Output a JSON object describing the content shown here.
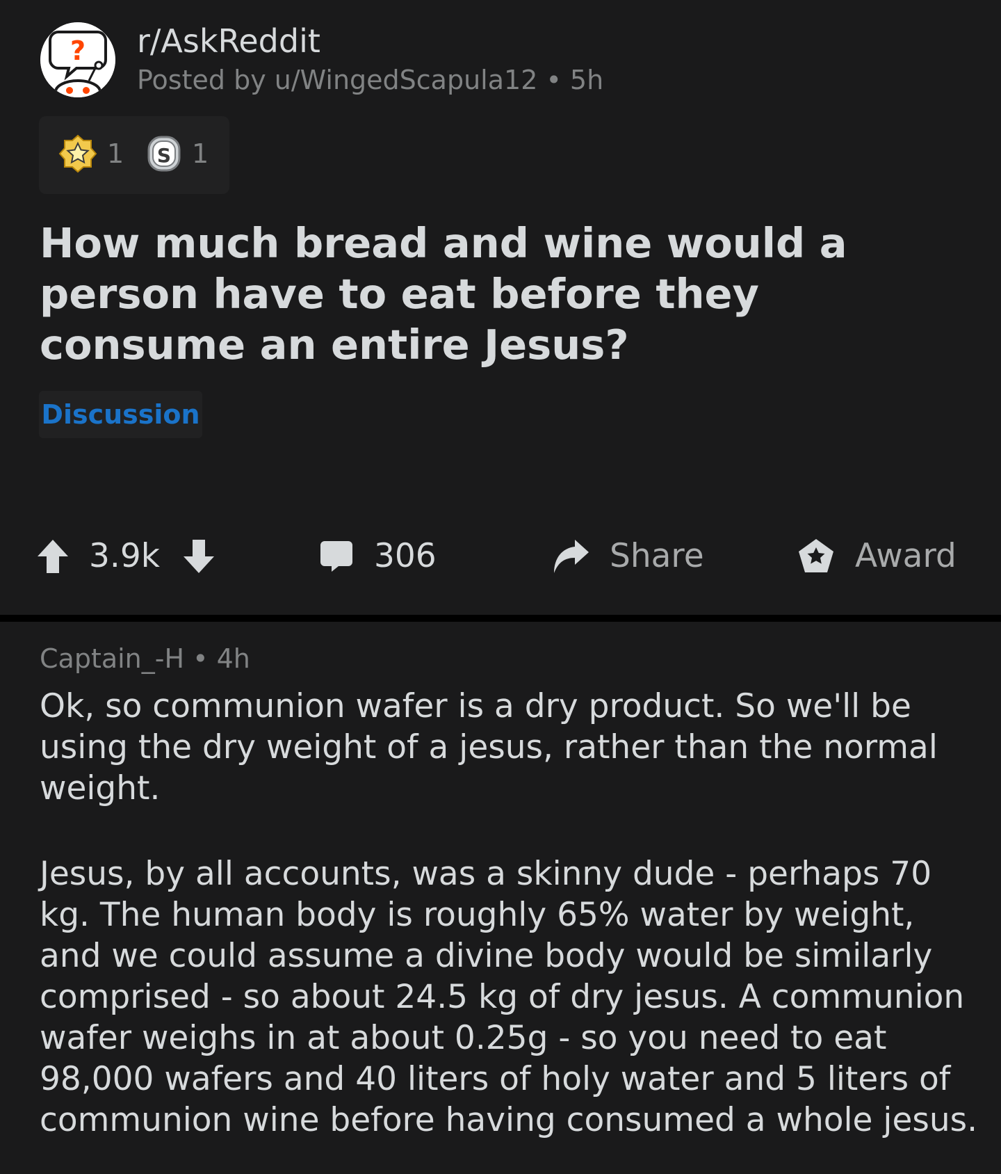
{
  "colors": {
    "background": "#1a1a1b",
    "separator": "#000000",
    "text_primary": "#d7dadc",
    "text_secondary": "#818384",
    "flair_text": "#1a73c9",
    "avatar_question_mark": "#ff4500"
  },
  "post": {
    "subreddit": "r/AskReddit",
    "posted_by": "Posted by u/WingedScapula12 • 5h",
    "avatar_icon": "askreddit-snoo-question-icon",
    "awards": [
      {
        "icon": "gold-star-award-icon",
        "count": "1"
      },
      {
        "icon": "silver-coin-award-icon",
        "count": "1"
      }
    ],
    "title": "How much bread and wine would a person have to eat before they consume an entire Jesus?",
    "flair": "Discussion"
  },
  "actions": {
    "upvote_icon": "upvote-arrow-icon",
    "score": "3.9k",
    "downvote_icon": "downvote-arrow-icon",
    "comment_icon": "comment-bubble-icon",
    "comments": "306",
    "share_icon": "share-arrow-icon",
    "share": "Share",
    "award_icon": "award-star-icon",
    "award": "Award"
  },
  "comment": {
    "author_meta": "Captain_-H • 4h",
    "paragraphs": [
      "Ok, so communion wafer is a dry product. So we'll be using the dry weight of a jesus, rather than the normal weight.",
      "Jesus, by all accounts, was a skinny dude - perhaps 70 kg. The human body is roughly 65% water by weight, and we could assume a divine body would be similarly comprised - so about 24.5 kg of dry jesus. A communion wafer weighs in at about 0.25g - so you need to eat 98,000 wafers and 40 liters of holy water and 5 liters of communion wine before having consumed a whole jesus."
    ]
  }
}
